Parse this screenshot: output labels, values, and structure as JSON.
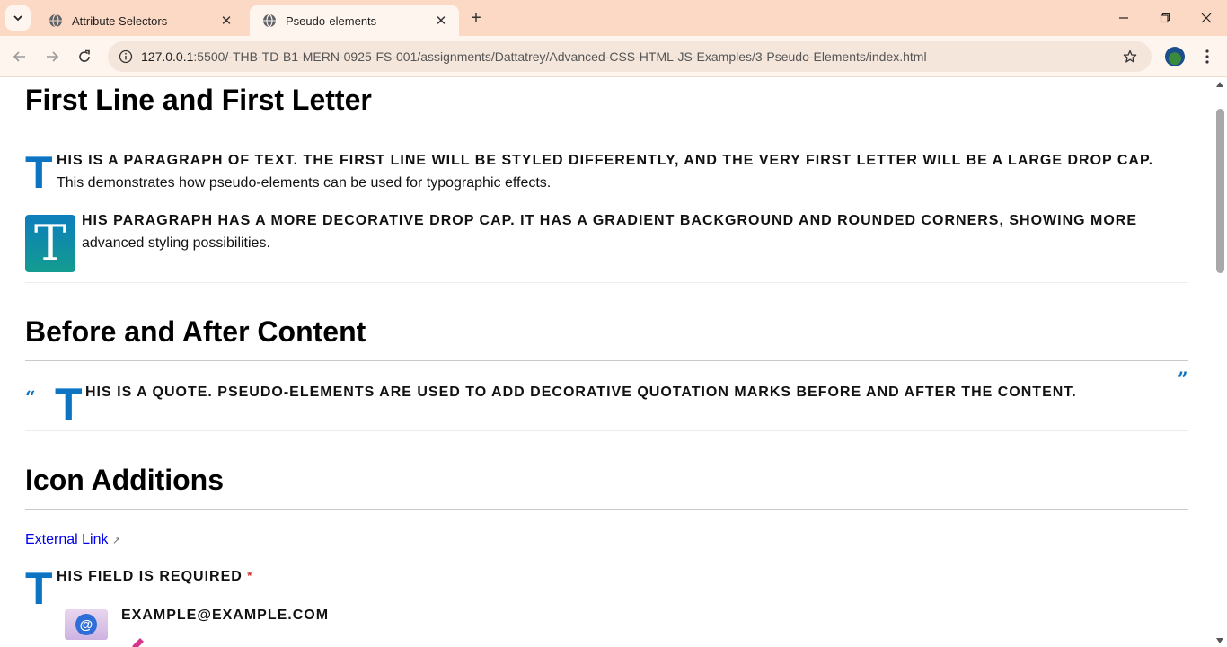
{
  "browser": {
    "tabs": [
      {
        "title": "Attribute Selectors",
        "active": false
      },
      {
        "title": "Pseudo-elements",
        "active": true
      }
    ],
    "address": {
      "host": "127.0.0.1",
      "path": ":5500/-THB-TD-B1-MERN-0925-FS-001/assignments/Dattatrey/Advanced-CSS-HTML-JS-Examples/3-Pseudo-Elements/index.html"
    },
    "icons": {
      "tab_search": "chevron-down-icon",
      "favicon": "globe-icon",
      "new_tab": "plus-icon",
      "back": "arrow-left-icon",
      "forward": "arrow-right-icon",
      "reload": "reload-icon",
      "site_info": "info-icon",
      "bookmark": "star-icon",
      "menu": "more-vertical-icon"
    },
    "colors": {
      "tabstrip": "#fcd9c4",
      "toolbar": "#fff5ef"
    }
  },
  "page": {
    "sections": [
      {
        "title": "First Line and First Letter",
        "paragraphs": [
          {
            "drop_letter": "T",
            "first_line": "HIS IS A PARAGRAPH OF TEXT. THE FIRST LINE WILL BE STYLED DIFFERENTLY, AND THE VERY FIRST LETTER WILL BE A LARGE DROP CAP.",
            "rest": "This demonstrates how pseudo-elements can be used for typographic effects."
          },
          {
            "drop_letter": "T",
            "first_line": "HIS PARAGRAPH HAS A MORE DECORATIVE DROP CAP. IT HAS A GRADIENT BACKGROUND AND ROUNDED CORNERS, SHOWING MORE",
            "rest": "advanced styling possibilities."
          }
        ]
      },
      {
        "title": "Before and After Content",
        "quote": {
          "open_mark": "“",
          "drop_letter": "T",
          "text": "HIS IS A QUOTE. PSEUDO-ELEMENTS ARE USED TO ADD DECORATIVE QUOTATION MARKS BEFORE AND AFTER THE CONTENT.",
          "close_mark": "”"
        }
      },
      {
        "title": "Icon Additions",
        "link": {
          "text": "External Link",
          "arrow": "↗"
        },
        "required": {
          "drop_letter": "T",
          "text": "HIS FIELD IS REQUIRED",
          "marker": "*"
        },
        "email": {
          "icon_symbol": "@",
          "text": "EXAMPLE@EXAMPLE.COM"
        }
      }
    ],
    "accent_color": "#0d74c4"
  }
}
